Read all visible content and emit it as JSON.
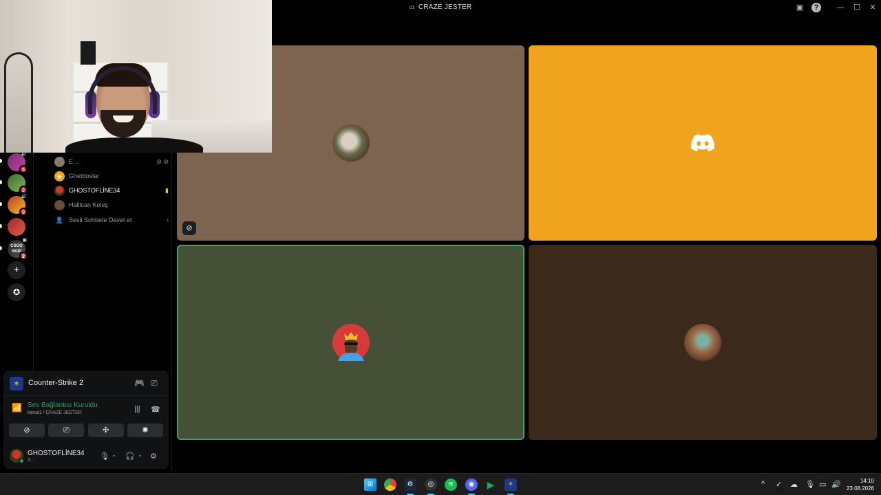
{
  "window": {
    "title": "CRAZE JESTER",
    "channel_glyph": "ᴄɪ",
    "inbox_icon": "inbox-icon",
    "help_icon": "help-icon"
  },
  "servers": [
    {
      "badge": "5",
      "colors": [
        "#7a2a6e",
        "#c04aa0"
      ]
    },
    {
      "badge": "2",
      "colors": [
        "#3a6e3a",
        "#8ab04a"
      ]
    },
    {
      "badge": "9",
      "colors": [
        "#c0382a",
        "#f0c020"
      ]
    },
    {
      "badge": "",
      "colors": [
        "#a02a2a",
        "#e05a4a"
      ]
    },
    {
      "badge": "2",
      "label": "CSGO SKIP",
      "colors": [
        "#222",
        "#555"
      ]
    }
  ],
  "voice_members": [
    {
      "name": "E...",
      "right": "⊘ ⊘"
    },
    {
      "name": "Ghetttostar",
      "right": ""
    },
    {
      "name": "GHOSTOFLİNE34",
      "right": "▮"
    },
    {
      "name": "Halilcan Keleş",
      "right": ""
    }
  ],
  "invite": {
    "label": "Sesli Sohbete Davet et",
    "chevron": "›"
  },
  "activity": {
    "game": "Counter-Strike 2",
    "game_glyph": "✶"
  },
  "voice_status": {
    "title": "Ses Bağlantısı Kuruldu",
    "subtitle": "kanal1 / CRAZE JESTER"
  },
  "voice_buttons": [
    "⊘",
    "⎚",
    "✣",
    "✺"
  ],
  "user": {
    "name": "GHOSTOFLİNE34",
    "status": "3..."
  },
  "tiles": {
    "muted_glyph": "⊘"
  },
  "taskbar": {
    "time": "14:10",
    "date": "23.08.2026"
  }
}
